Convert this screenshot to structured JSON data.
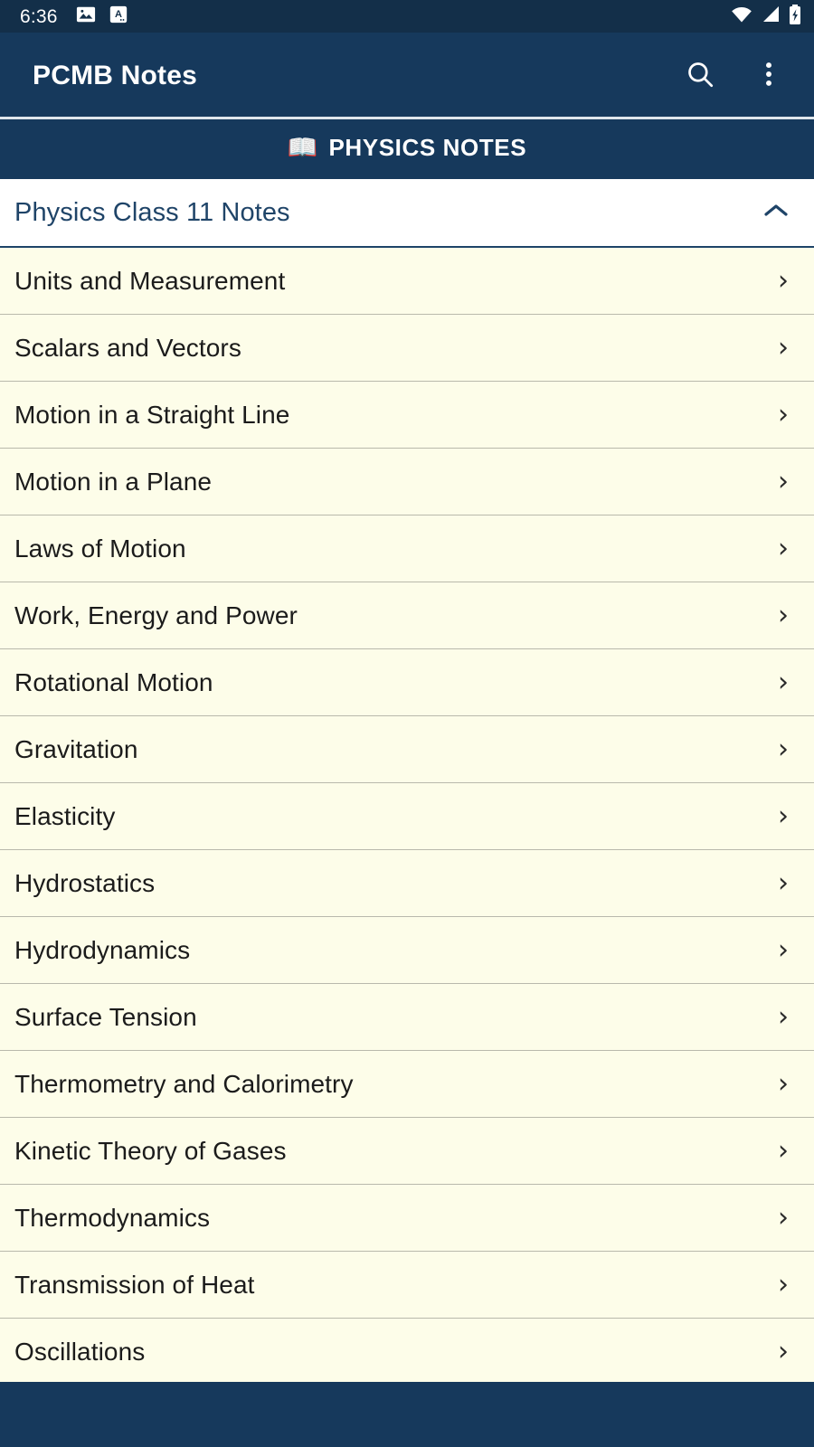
{
  "statusbar": {
    "time": "6:36",
    "left_icons": [
      "image-icon",
      "text-badge-icon"
    ],
    "right_icons": [
      "wifi-icon",
      "cellular-signal-icon",
      "battery-charging-icon"
    ],
    "background_color": "#132f49"
  },
  "toolbar": {
    "title": "PCMB Notes",
    "search_label": "search-icon",
    "overflow_label": "more-options-icon",
    "background_color": "#16395c",
    "text_color": "#ffffff"
  },
  "banner": {
    "emoji": "📖",
    "text": "PHYSICS NOTES",
    "background_color": "#16395c"
  },
  "accordion": {
    "title": "Physics Class 11 Notes",
    "expanded": true,
    "chevron": "chevron-up-icon",
    "text_color": "#1f4468",
    "background_color": "#ffffff"
  },
  "list": {
    "background_color": "#fdfde9",
    "divider_color": "#b9b9ac",
    "row_chevron": "›",
    "items": [
      {
        "label": "Units and Measurement"
      },
      {
        "label": "Scalars and Vectors"
      },
      {
        "label": "Motion in a Straight Line"
      },
      {
        "label": "Motion in a Plane"
      },
      {
        "label": "Laws of Motion"
      },
      {
        "label": "Work, Energy and Power"
      },
      {
        "label": "Rotational Motion"
      },
      {
        "label": "Gravitation"
      },
      {
        "label": "Elasticity"
      },
      {
        "label": "Hydrostatics"
      },
      {
        "label": "Hydrodynamics"
      },
      {
        "label": "Surface Tension"
      },
      {
        "label": "Thermometry and Calorimetry"
      },
      {
        "label": "Kinetic Theory of Gases"
      },
      {
        "label": "Thermodynamics"
      },
      {
        "label": "Transmission of Heat"
      },
      {
        "label": "Oscillations"
      }
    ]
  },
  "bottom_nav": {
    "background_color": "#16395c"
  }
}
